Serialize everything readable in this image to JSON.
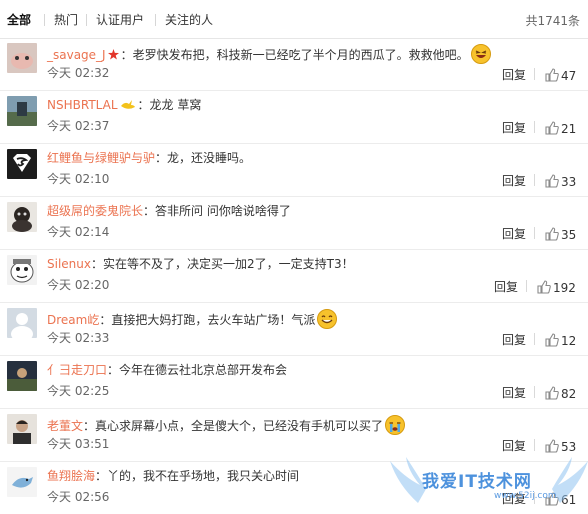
{
  "tabs": [
    {
      "label": "全部",
      "active": true
    },
    {
      "label": "热门",
      "active": false
    },
    {
      "label": "认证用户",
      "active": false
    },
    {
      "label": "关注的人",
      "active": false
    }
  ],
  "total_count": "共1741条",
  "reply_label": "回复",
  "comments": [
    {
      "user": "_savage_J",
      "text": "：老罗快发布把，科技新一已经吃了半个月的西瓜了。救救他吧。",
      "time": "今天 02:32",
      "likes": "47",
      "badge": "star",
      "emoji": "laugh"
    },
    {
      "user": "NSHBRTLAL",
      "text": "：龙龙 草窝",
      "time": "今天 02:37",
      "likes": "21",
      "badge": "bird",
      "emoji": ""
    },
    {
      "user": "红鲤鱼与绿鲤驴与驴",
      "text": "：龙，还没睡吗。",
      "time": "今天 02:10",
      "likes": "33",
      "badge": "",
      "emoji": ""
    },
    {
      "user": "超级屌的委鬼院长",
      "text": "：答非所问 问你啥说啥得了",
      "time": "今天 02:14",
      "likes": "35",
      "badge": "",
      "emoji": ""
    },
    {
      "user": "Silenux",
      "text": "：实在等不及了，决定买一加2了，一定支持T3！",
      "time": "今天 02:20",
      "likes": "192",
      "badge": "",
      "emoji": ""
    },
    {
      "user": "Dream屹",
      "text": "：直接把大妈打跑，去火车站广场！气派",
      "time": "今天 02:33",
      "likes": "12",
      "badge": "",
      "emoji": "grin"
    },
    {
      "user": "亻彐走刀口",
      "text": "：今年在德云社北京总部开发布会",
      "time": "今天 02:25",
      "likes": "82",
      "badge": "",
      "emoji": ""
    },
    {
      "user": "老董文",
      "text": "：真心求屏幕小点，全是傻大个，已经没有手机可以买了",
      "time": "今天 03:51",
      "likes": "53",
      "badge": "",
      "emoji": "cry"
    },
    {
      "user": "鱼翔脍海",
      "text": "：丫的，我不在乎场地，我只关心时间",
      "time": "今天 02:56",
      "likes": "61",
      "badge": "",
      "emoji": ""
    }
  ],
  "watermark": {
    "text": "我爱IT技术网",
    "url": "www.52ij.com"
  },
  "colors": {
    "username": "#eb7350",
    "watermark": "#2f7fd8"
  }
}
